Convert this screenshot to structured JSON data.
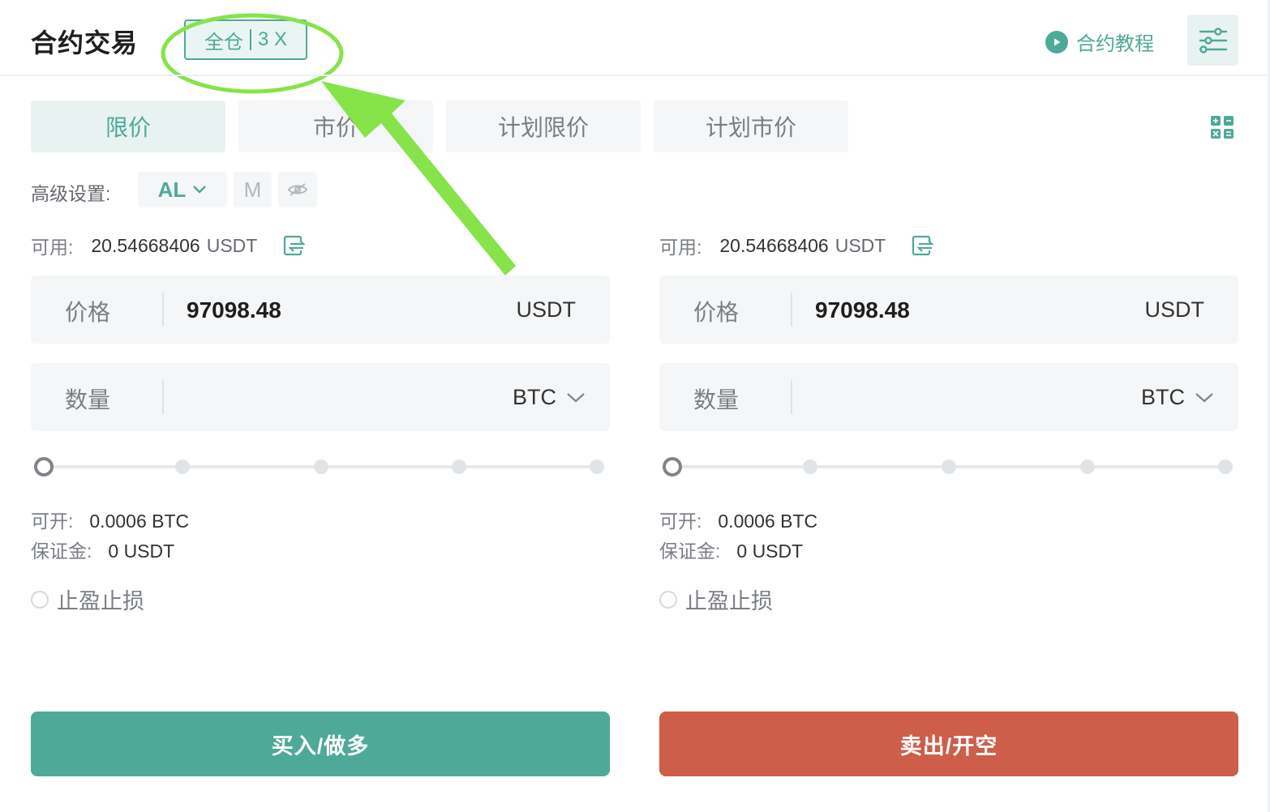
{
  "header": {
    "title": "合约交易",
    "margin_mode": "全仓",
    "leverage": "3 X",
    "tutorial_label": "合约教程"
  },
  "order_tabs": [
    {
      "label": "限价",
      "active": true
    },
    {
      "label": "市价",
      "active": false
    },
    {
      "label": "计划限价",
      "active": false
    },
    {
      "label": "计划市价",
      "active": false
    }
  ],
  "advanced": {
    "label": "高级设置:",
    "al_label": "AL",
    "m_label": "M"
  },
  "buy_panel": {
    "available_label": "可用:",
    "available_value": "20.54668406",
    "available_unit": "USDT",
    "price_label": "价格",
    "price_value": "97098.48",
    "price_unit": "USDT",
    "qty_label": "数量",
    "qty_unit": "BTC",
    "slider_value_pct": 0,
    "openable_label": "可开:",
    "openable_value": "0.0006 BTC",
    "margin_label": "保证金:",
    "margin_value": "0 USDT",
    "tpsl_label": "止盈止损",
    "button_label": "买入/做多"
  },
  "sell_panel": {
    "available_label": "可用:",
    "available_value": "20.54668406",
    "available_unit": "USDT",
    "price_label": "价格",
    "price_value": "97098.48",
    "price_unit": "USDT",
    "qty_label": "数量",
    "qty_unit": "BTC",
    "slider_value_pct": 0,
    "openable_label": "可开:",
    "openable_value": "0.0006 BTC",
    "margin_label": "保证金:",
    "margin_value": "0 USDT",
    "tpsl_label": "止盈止损",
    "button_label": "卖出/开空"
  },
  "colors": {
    "accent": "#4fa998",
    "buy": "#4fa998",
    "sell": "#cc5e4a",
    "annotation": "#86e34a"
  },
  "icons": [
    "play-icon",
    "settings-sliders-icon",
    "calculator-icon",
    "chevron-down-icon",
    "eye-slash-icon",
    "transfer-icon",
    "radio-icon"
  ]
}
